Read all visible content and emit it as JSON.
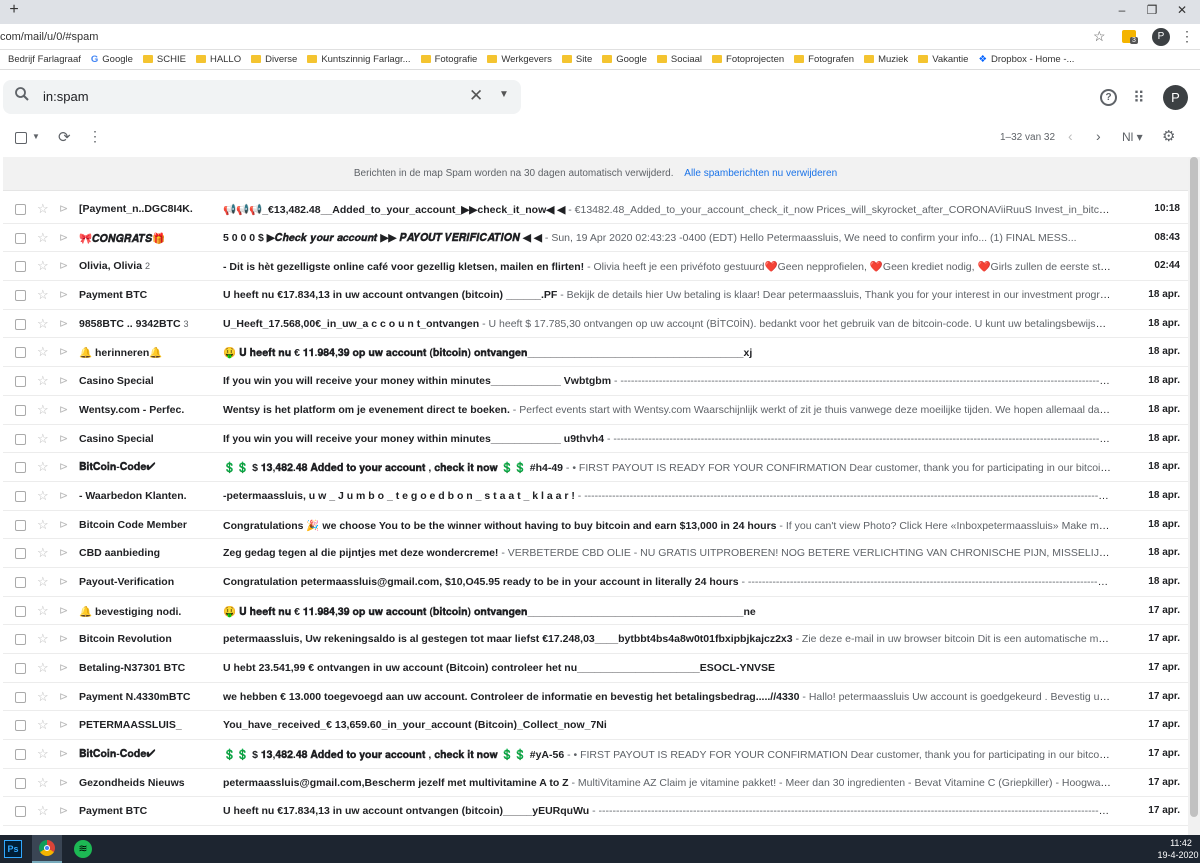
{
  "browser": {
    "newtab_glyph": "+",
    "url": "com/mail/u/0/#spam",
    "extension_badge": "3",
    "profile_initial": "P",
    "minimize": "–",
    "maximize": "❐",
    "close": "✕"
  },
  "bookmarks": [
    {
      "label": "Bedrijf Farlagraaf",
      "icon": "none"
    },
    {
      "label": "Google",
      "icon": "google-icon"
    },
    {
      "label": "SCHIE",
      "icon": "folder-icon"
    },
    {
      "label": "HALLO",
      "icon": "folder-icon"
    },
    {
      "label": "Diverse",
      "icon": "folder-icon"
    },
    {
      "label": "Kuntszinnig Farlagr...",
      "icon": "folder-icon"
    },
    {
      "label": "Fotografie",
      "icon": "folder-icon"
    },
    {
      "label": "Werkgevers",
      "icon": "folder-icon"
    },
    {
      "label": "Site",
      "icon": "folder-icon"
    },
    {
      "label": "Google",
      "icon": "folder-icon"
    },
    {
      "label": "Sociaal",
      "icon": "folder-icon"
    },
    {
      "label": "Fotoprojecten",
      "icon": "folder-icon"
    },
    {
      "label": "Fotografen",
      "icon": "folder-icon"
    },
    {
      "label": "Muziek",
      "icon": "folder-icon"
    },
    {
      "label": "Vakantie",
      "icon": "folder-icon"
    },
    {
      "label": "Dropbox - Home -...",
      "icon": "dropbox-icon"
    }
  ],
  "search": {
    "value": "in:spam"
  },
  "account": {
    "initial": "P"
  },
  "toolbar": {
    "page_count": "1–32 van 32",
    "lang": "Nl ▾"
  },
  "notice": {
    "text": "Berichten in de map Spam worden na 30 dagen automatisch verwijderd.",
    "link": "Alle spamberichten nu verwijderen"
  },
  "emails": [
    {
      "sender": "[Payment_n..DGC8I4K.",
      "count": "",
      "subject": "📢📢📢_€13,482.48__Added_to_your_account_▶▶check_it_now◀ ◀",
      "snippet": " - €13482.48_Added_to_your_account_check_it_now Prices_will_skyrocket_after_CORONAViiRuuS Invest_in_bitco...",
      "date": "10:18"
    },
    {
      "sender": "🎀𝑪𝑶𝑵𝑮𝑹𝑨𝑻𝑺🎁",
      "count": "",
      "subject": "5 0 0 0 $ ▶𝑪𝒉𝒆𝒄𝒌 𝒚𝒐𝒖𝒓 𝒂𝒄𝒄𝒐𝒖𝒏𝒕 ▶▶ 𝑷𝑨𝒀𝑶𝑼𝑻 𝑽𝑬𝑹𝑰𝑭𝑰𝑪𝑨𝑻𝑰𝑶𝑵 ◀ ◀",
      "snippet": " - Sun, 19 Apr 2020 02:43:23 -0400 (EDT) Hello Petermaassluis, We need to confirm your info... (1) FINAL MESS...",
      "date": "08:43"
    },
    {
      "sender": "Olivia, Olivia",
      "count": "2",
      "subject": "- Dit is hèt gezelligste online café voor gezellig kletsen, mailen en flirten!",
      "snippet": " - Olivia heeft je een privéfoto gestuurd❤️Geen nepprofielen, ❤️Geen krediet nodig, ❤️Girls zullen de eerste stap zett...",
      "date": "02:44"
    },
    {
      "sender": "Payment BTC",
      "count": "",
      "subject": "U heeft nu €17.834,13 in uw account ontvangen (bitcoin) ______.PF",
      "snippet": " - Bekijk de details hier Uw betaling is klaar! Dear petermaassluis, Thank you for your interest in our investment program. W...",
      "date": "18 apr."
    },
    {
      "sender": "9858BTC .. 9342BTC",
      "count": "3",
      "subject": "U_Heeft_17.568,00€_in_uw_a c c o u n t_ontvangen",
      "snippet": " - U heeft $ 17.785,30 ontvangen op uw accoųnt (BİTC0İN). bedankt voor het gebruik van de bitcoin-code. U kunt uw betalingsbewijsvoucher...",
      "date": "18 apr."
    },
    {
      "sender": "🔔 herinneren🔔",
      "count": "",
      "subject": "🤑 𝐔 𝐡𝐞𝐞𝐟𝐭 𝐧𝐮 € 𝟏𝟏.𝟗𝟖𝟒,𝟑𝟗 𝐨𝐩 𝐮𝐰 𝐚𝐜𝐜𝐨𝐮𝐧𝐭 (𝐛𝐢𝐭𝐜𝐨𝐢𝐧) 𝐨𝐧𝐭𝐯𝐚𝐧𝐠𝐞𝐧_____________________________________xj",
      "snippet": "",
      "date": "18 apr."
    },
    {
      "sender": "Casino Special",
      "count": "",
      "subject": "If you win you will receive your money within minutes____________ Vwbtgbm",
      "snippet": " - ------------------------------------------------------------------------------------------------------------------------------------------------------------------------",
      "date": "18 apr."
    },
    {
      "sender": "Wentsy.com - Perfec.",
      "count": "",
      "subject": "Wentsy is het platform om je evenement direct te boeken.",
      "snippet": " - Perfect events start with Wentsy.com Waarschijnlijk werkt of zit je thuis vanwege deze moeilijke tijden. We hopen allemaal dat het ...",
      "date": "18 apr."
    },
    {
      "sender": "Casino Special",
      "count": "",
      "subject": "If you win you will receive your money within minutes____________ u9thvh4",
      "snippet": " - ------------------------------------------------------------------------------------------------------------------------------------------------------------------------",
      "date": "18 apr."
    },
    {
      "sender": "𝐁𝐢𝐭𝐂𝐨𝐢𝐧-𝐂𝐨𝐝𝐞✔",
      "count": "",
      "subject": "💲💲 $ 𝟏𝟑,𝟒𝟖𝟐.𝟒𝟖 𝐀𝐝𝐝𝐞𝐝 𝐭𝐨 𝐲𝐨𝐮𝐫 𝐚𝐜𝐜𝐨𝐮𝐧𝐭 , 𝐜𝐡𝐞𝐜𝐤 𝐢𝐭 𝐧𝐨𝐰 💲💲 #h4-49",
      "snippet": " - • FIRST PAYOUT IS READY FOR YOUR CONFIRMATION Dear customer, thank you for participating in our bitcoin program...",
      "date": "18 apr."
    },
    {
      "sender": "- Waarbedon Klanten.",
      "count": "",
      "subject": "-petermaassluis, u w _ J u m b o _ t e g o e d b o n _ s t a a t _ k l a a r !",
      "snippet": " - ------------------------------------------------------------------------------------------------------------------------------------------------------------------------",
      "date": "18 apr."
    },
    {
      "sender": "Bitcoin Code Member",
      "count": "",
      "subject": "Congratulations 🎉 we choose You to be the winner without having to buy bitcoin and earn $13,000 in 24 hours",
      "snippet": " - If you can't view Photo? Click Here «Inboxpetermaassluis» Make money$ wit...",
      "date": "18 apr."
    },
    {
      "sender": "CBD aanbieding",
      "count": "",
      "subject": "Zeg gedag tegen al die pijntjes met deze wondercreme!",
      "snippet": " - VERBETERDE CBD OLIE - NU GRATIS UITPROBEREN! NOG BETERE VERLICHTING VAN CHRONISCHE PIJN, MISSELIJKHEID EN STRES...",
      "date": "18 apr."
    },
    {
      "sender": "Payout-Verification",
      "count": "",
      "subject": "Congratulation petermaassluis@gmail.com, $10,O45.95 ready to be in your account in literally 24 hours",
      "snippet": " - ------------------------------------------------------------------------------------------------------------------------------------------------------------------------",
      "date": "18 apr."
    },
    {
      "sender": "🔔 bevestiging nodi.",
      "count": "",
      "subject": "🤑 𝐔 𝐡𝐞𝐞𝐟𝐭 𝐧𝐮 € 𝟏𝟏.𝟗𝟖𝟒,𝟑𝟗 𝐨𝐩 𝐮𝐰 𝐚𝐜𝐜𝐨𝐮𝐧𝐭 (𝐛𝐢𝐭𝐜𝐨𝐢𝐧) 𝐨𝐧𝐭𝐯𝐚𝐧𝐠𝐞𝐧_____________________________________ne",
      "snippet": "",
      "date": "17 apr."
    },
    {
      "sender": "Bitcoin Revolution",
      "count": "",
      "subject": "petermaassluis, Uw rekeningsaldo is al gestegen tot maar liefst €17.248,03____bytbbt4bs4a8w0t01fbxipbjkajcz2x3",
      "snippet": " - Zie deze e-mail in uw browser bitcoin Dit is een automatische melding o...",
      "date": "17 apr."
    },
    {
      "sender": "Betaling-N37301 BTC",
      "count": "",
      "subject": "U hebt 23.541,99 € ontvangen in uw account (Bitcoin) controleer het nu_____________________ESOCL-YNVSE",
      "snippet": "",
      "date": "17 apr."
    },
    {
      "sender": "Payment N.4330mBTC",
      "count": "",
      "subject": "we hebben € 13.000 toegevoegd aan uw account. Controleer de informatie en bevestig het betalingsbedrag.....//4330",
      "snippet": " - Hallo! petermaassluis Uw account is goedgekeurd . Bevestig uw abonn...",
      "date": "17 apr."
    },
    {
      "sender": "PETERMAASSLUIS_",
      "count": "",
      "subject": "You_have_received_€ 13,659.60_in_your_account (Bitcoin)_Collect_now_7Ni",
      "snippet": "",
      "date": "17 apr."
    },
    {
      "sender": "𝐁𝐢𝐭𝐂𝐨𝐢𝐧-𝐂𝐨𝐝𝐞✔",
      "count": "",
      "subject": "💲💲 $ 𝟏𝟑,𝟒𝟖𝟐.𝟒𝟖 𝐀𝐝𝐝𝐞𝐝 𝐭𝐨 𝐲𝐨𝐮𝐫 𝐚𝐜𝐜𝐨𝐮𝐧𝐭 , 𝐜𝐡𝐞𝐜𝐤 𝐢𝐭 𝐧𝐨𝐰 💲💲 #yA-56",
      "snippet": " - • FIRST PAYOUT IS READY FOR YOUR CONFIRMATION Dear customer, thank you for participating in our bitcoin program...",
      "date": "17 apr."
    },
    {
      "sender": "Gezondheids Nieuws",
      "count": "",
      "subject": "petermaassluis@gmail.com,Bescherm jezelf met multivitamine A to Z",
      "snippet": " - MultiVitamine AZ Claim je vitamine pakket! - Meer dan 30 ingredienten - Bevat Vitamine C (Griepkiller) - Hoogwaardige ...",
      "date": "17 apr."
    },
    {
      "sender": "Payment BTC",
      "count": "",
      "subject": "U heeft nu €17.834,13 in uw account ontvangen (bitcoin)_____yEURquWu",
      "snippet": " - ------------------------------------------------------------------------------------------------------------------------------------------------------------------------",
      "date": "17 apr."
    }
  ],
  "taskbar": {
    "ps_label": "Ps",
    "time": "11:42",
    "date": "19-4-2020"
  }
}
